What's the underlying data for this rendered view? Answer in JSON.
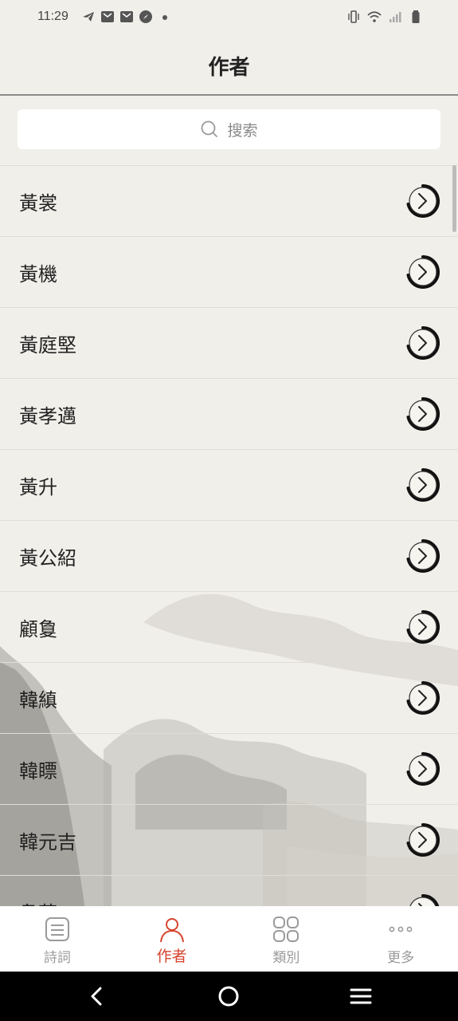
{
  "status_bar": {
    "time": "11:29",
    "left_icons": [
      "telegram-icon",
      "mail-icon",
      "mail-icon",
      "compass-icon",
      "dot-icon"
    ],
    "right_icons": [
      "vibrate-icon",
      "wifi-icon",
      "signal-icon",
      "battery-icon"
    ]
  },
  "header": {
    "title": "作者"
  },
  "search": {
    "placeholder": "搜索"
  },
  "authors": [
    {
      "name": "黃裳"
    },
    {
      "name": "黃機"
    },
    {
      "name": "黃庭堅"
    },
    {
      "name": "黃孝邁"
    },
    {
      "name": "黃升"
    },
    {
      "name": "黃公紹"
    },
    {
      "name": "顧敻"
    },
    {
      "name": "韓縝"
    },
    {
      "name": "韓瞟"
    },
    {
      "name": "韓元吉"
    },
    {
      "name": "韋莊"
    }
  ],
  "tabs": [
    {
      "label": "詩詞",
      "icon": "document-icon",
      "active": false
    },
    {
      "label": "作者",
      "icon": "person-icon",
      "active": true
    },
    {
      "label": "類別",
      "icon": "grid-icon",
      "active": false
    },
    {
      "label": "更多",
      "icon": "more-icon",
      "active": false
    }
  ],
  "colors": {
    "accent": "#d6452e",
    "background": "#f1efea",
    "divider": "#8c8c8c"
  },
  "nav": [
    "back-icon",
    "home-icon",
    "menu-icon"
  ]
}
